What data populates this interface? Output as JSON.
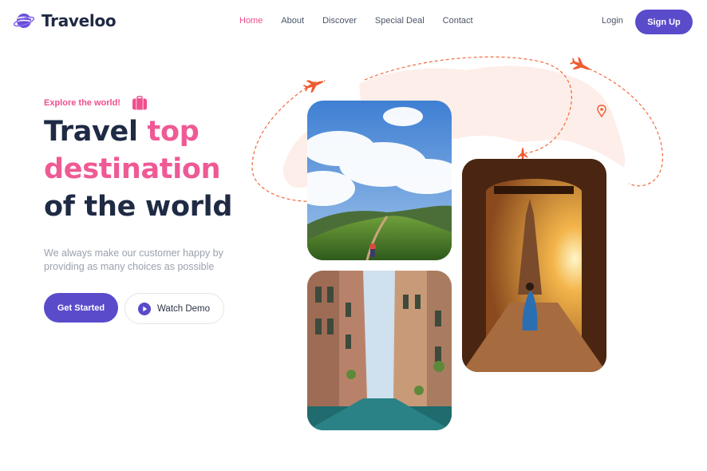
{
  "brand": {
    "name": "Traveloo",
    "logo_icon": "globe-icon"
  },
  "nav": {
    "items": [
      {
        "label": "Home",
        "active": true
      },
      {
        "label": "About",
        "active": false
      },
      {
        "label": "Discover",
        "active": false
      },
      {
        "label": "Special Deal",
        "active": false
      },
      {
        "label": "Contact",
        "active": false
      }
    ],
    "login_label": "Login",
    "signup_label": "Sign Up"
  },
  "hero": {
    "eyebrow": "Explore the world!",
    "eyebrow_icon": "suitcase-icon",
    "headline": {
      "part1": "Travel ",
      "accent1": "top",
      "accent2": "destination",
      "part2": "of the world"
    },
    "lead": "We always make our customer happy by providing as many choices as possible",
    "cta_primary": "Get Started",
    "cta_secondary": "Watch Demo",
    "cta_secondary_icon": "play-icon"
  },
  "gallery": {
    "images": [
      {
        "name": "mountain-trail-photo"
      },
      {
        "name": "venice-canal-photo"
      },
      {
        "name": "temple-sunset-photo"
      }
    ],
    "decor_icons": [
      "airplane-icon",
      "airplane-icon",
      "airplane-icon",
      "map-pin-icon"
    ]
  },
  "colors": {
    "accent_purple": "#5a4bcb",
    "accent_pink": "#ef4f8f",
    "heading": "#1f2a44",
    "body_text": "#9aa1ad",
    "flight_path": "#f06a3c"
  }
}
